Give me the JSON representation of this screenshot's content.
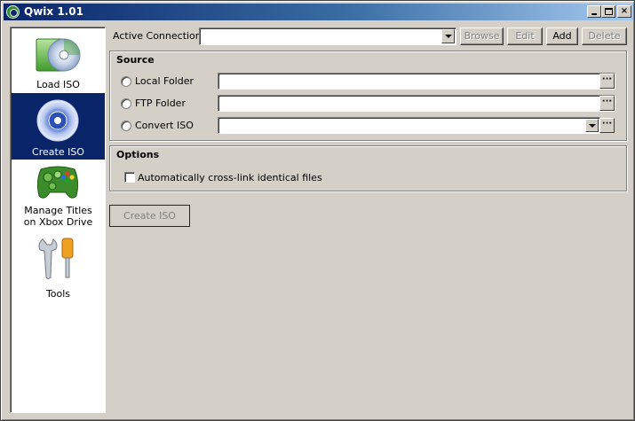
{
  "window": {
    "title": "Qwix 1.01"
  },
  "title_controls": {
    "minimize": "_",
    "maximize": "□",
    "close": "×"
  },
  "sidebar": {
    "items": [
      {
        "label": "Load ISO",
        "icon": "disc-folder-icon",
        "selected": false
      },
      {
        "label": "Create ISO",
        "icon": "disc-icon",
        "selected": true
      },
      {
        "label_line1": "Manage Titles",
        "label_line2": "on Xbox Drive",
        "icon": "gamepad-icon",
        "selected": false
      },
      {
        "label": "Tools",
        "icon": "tools-icon",
        "selected": false
      }
    ]
  },
  "connection": {
    "label": "Active Connection:",
    "value": "",
    "buttons": {
      "browse": "Browse",
      "edit": "Edit",
      "add": "Add",
      "delete": "Delete"
    }
  },
  "source": {
    "title": "Source",
    "local_folder": {
      "label": "Local Folder",
      "value": ""
    },
    "ftp_folder": {
      "label": "FTP Folder",
      "value": ""
    },
    "convert_iso": {
      "label": "Convert ISO",
      "value": ""
    },
    "browse_glyph": "···"
  },
  "options": {
    "title": "Options",
    "crosslink": {
      "label": "Automatically cross-link identical files",
      "checked": false
    }
  },
  "actions": {
    "create_iso": "Create ISO"
  },
  "colors": {
    "selection": "#0a246a",
    "face": "#d4d0c8"
  }
}
